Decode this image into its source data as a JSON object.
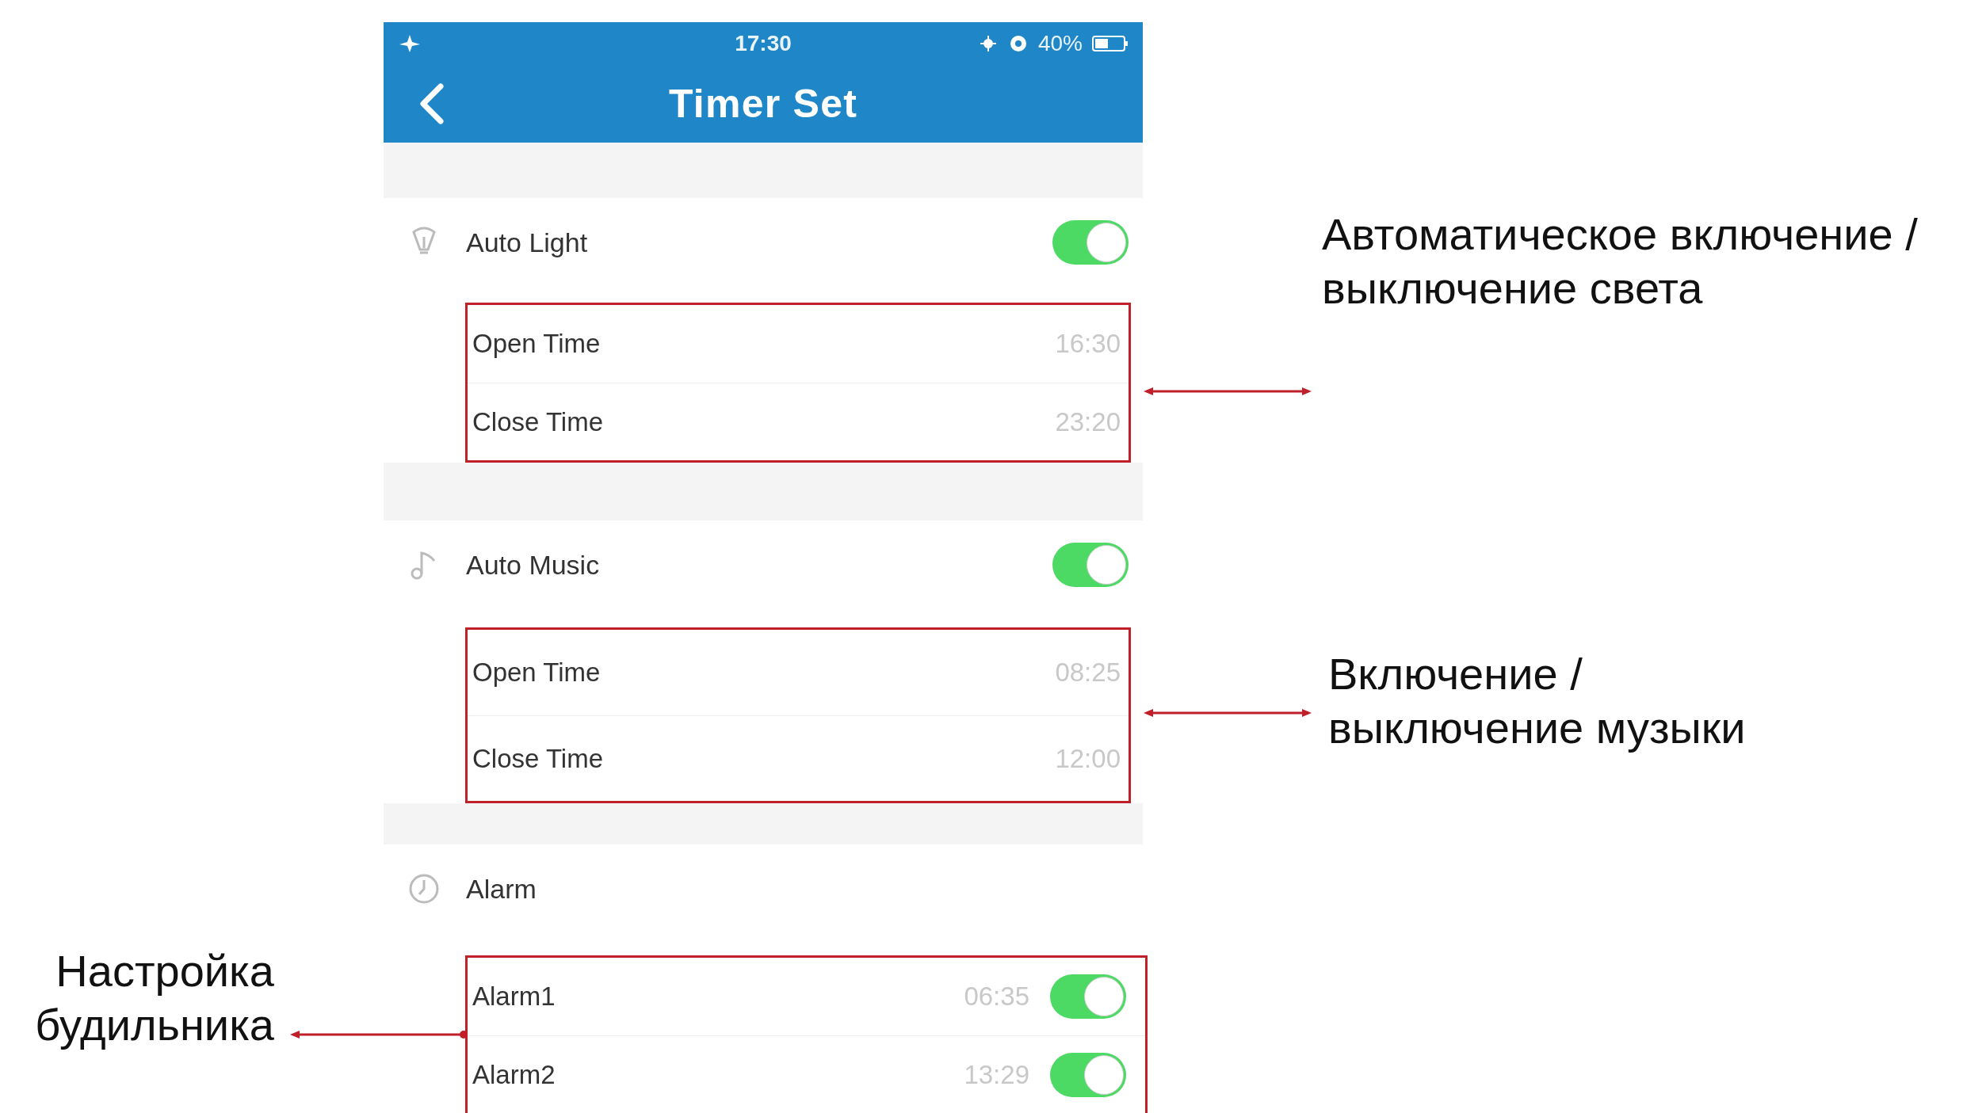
{
  "status_bar": {
    "time": "17:30",
    "battery": "40%"
  },
  "header": {
    "title": "Timer Set"
  },
  "sections": [
    {
      "kind": "toggle",
      "title": "Auto Light",
      "on": true,
      "rows": [
        {
          "kind": "time",
          "label": "Open Time",
          "value": "16:30"
        },
        {
          "kind": "time",
          "label": "Close Time",
          "value": "23:20"
        }
      ]
    },
    {
      "kind": "toggle",
      "title": "Auto Music",
      "on": true,
      "rows": [
        {
          "kind": "time",
          "label": "Open Time",
          "value": "08:25"
        },
        {
          "kind": "time",
          "label": "Close Time",
          "value": "12:00"
        }
      ]
    },
    {
      "kind": "plain",
      "title": "Alarm",
      "rows": [
        {
          "kind": "alarm",
          "label": "Alarm1",
          "value": "06:35",
          "on": true
        },
        {
          "kind": "alarm",
          "label": "Alarm2",
          "value": "13:29",
          "on": true
        }
      ]
    }
  ],
  "annotations": [
    {
      "lines": [
        "Автоматическое включение /",
        "выключение света"
      ]
    },
    {
      "lines": [
        "Включение /",
        "выключение музыки"
      ]
    },
    {
      "lines": [
        "Настройка",
        "будильника"
      ]
    }
  ]
}
